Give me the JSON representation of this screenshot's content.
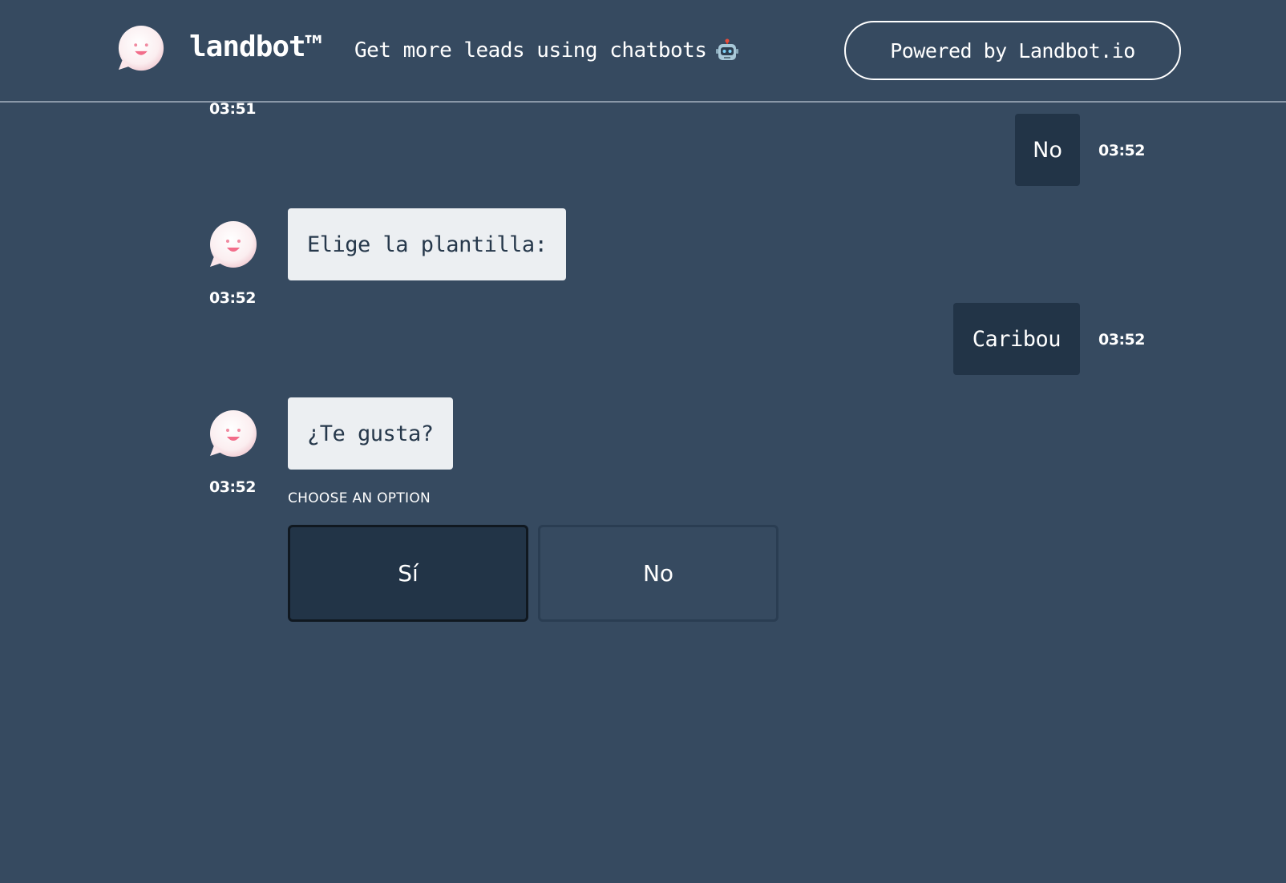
{
  "header": {
    "brand_name": "landbot™",
    "tagline": "Get more leads using chatbots",
    "tagline_icon": "robot-icon",
    "powered_label": "Powered by Landbot.io"
  },
  "messages": [
    {
      "from": "bot",
      "time": "03:51"
    },
    {
      "from": "user",
      "text": "No",
      "time": "03:52"
    },
    {
      "from": "bot",
      "text": "Elige la plantilla:",
      "time": "03:52"
    },
    {
      "from": "user",
      "text": "Caribou",
      "time": "03:52"
    },
    {
      "from": "bot",
      "text": "¿Te gusta?",
      "time": "03:52"
    }
  ],
  "options": {
    "label": "CHOOSE AN OPTION",
    "items": [
      "Sí",
      "No"
    ],
    "selected": "Sí"
  },
  "colors": {
    "background": "#364a60",
    "user_bubble": "#223447",
    "bot_bubble": "#eceff2",
    "bot_text": "#26384b"
  }
}
